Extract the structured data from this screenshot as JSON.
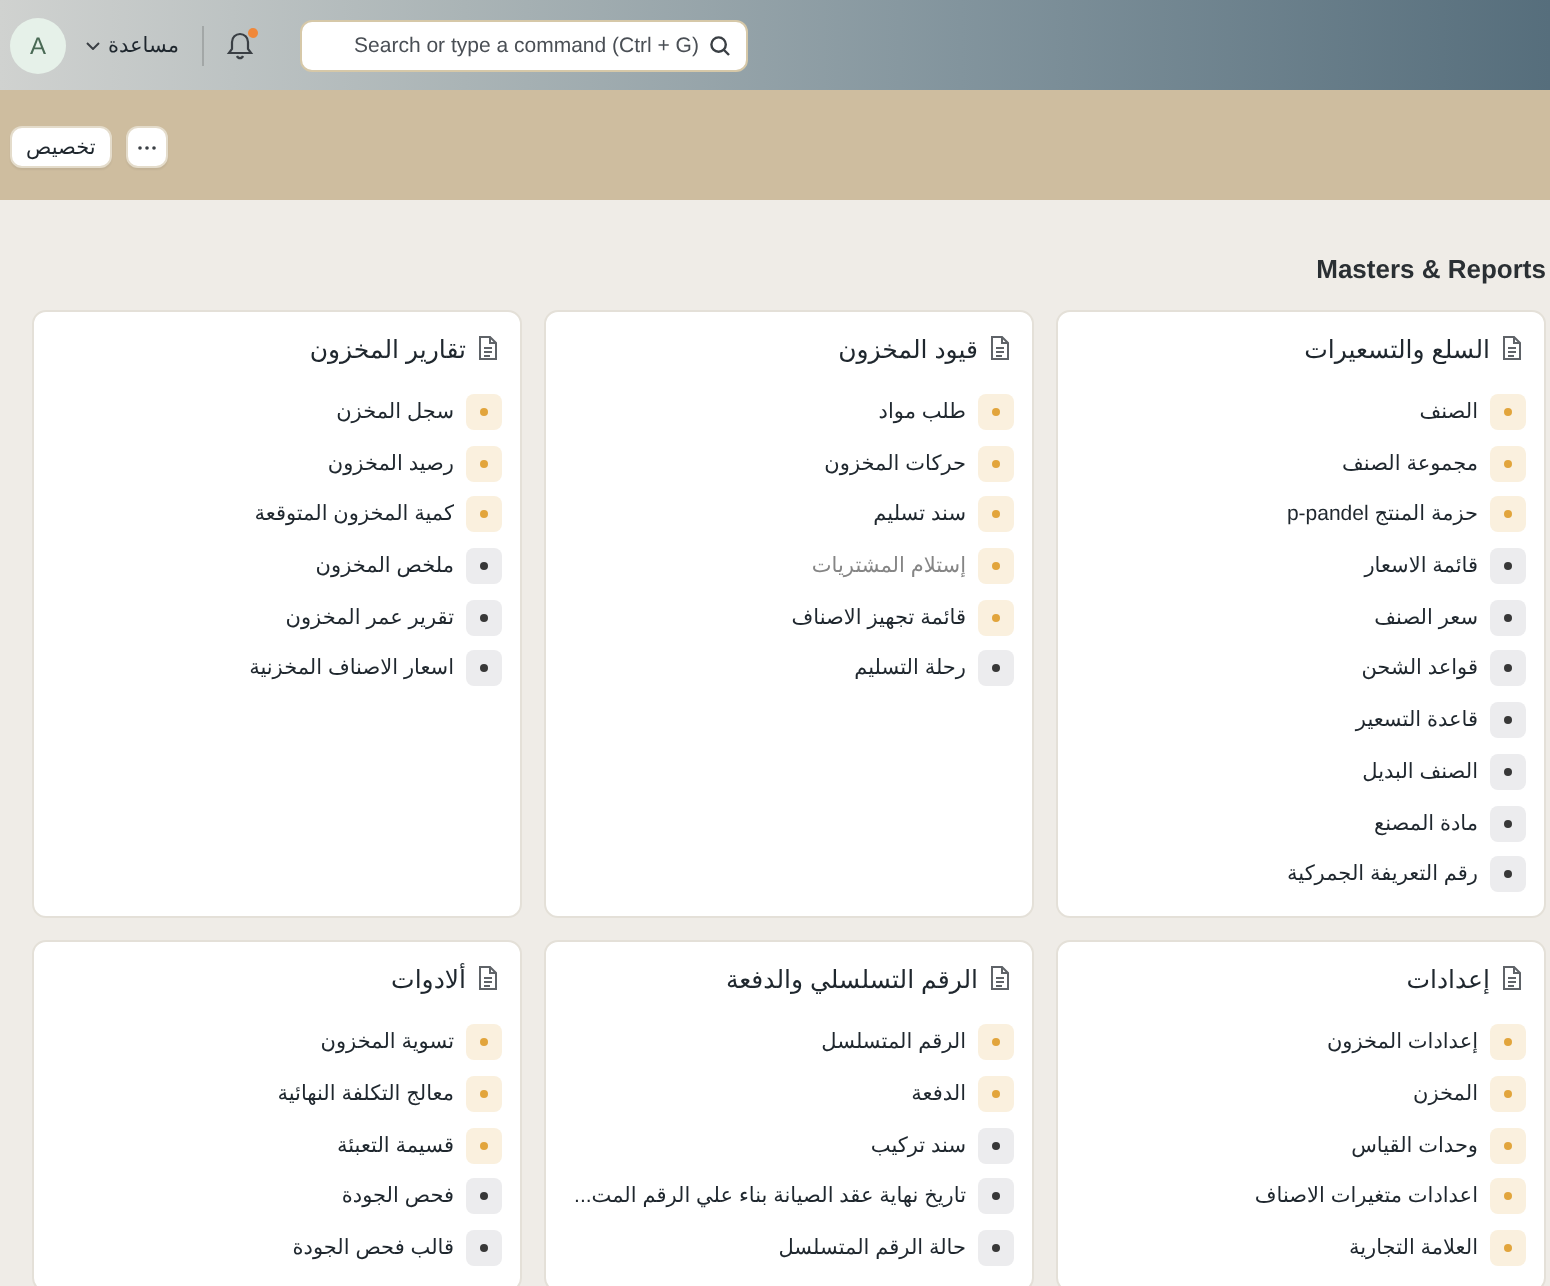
{
  "navbar": {
    "avatar": "A",
    "help": {
      "label": "مساعدة"
    },
    "notifications": {
      "unread": true
    },
    "search": {
      "placeholder": "Search or type a command (Ctrl + G)"
    }
  },
  "toolbar": {
    "buttons": [
      {
        "label": "تخصيص"
      }
    ]
  },
  "section": {
    "title": "Masters & Reports",
    "cards": [
      {
        "title": "السلع والتسعيرات",
        "items": [
          {
            "label": "الصنف",
            "color": "#e2a53c",
            "muted": false
          },
          {
            "label": "مجموعة الصنف",
            "color": "#e2a53c",
            "muted": false
          },
          {
            "label": "حزمة المنتج p-pandel",
            "color": "#e2a53c",
            "muted": false
          },
          {
            "label": "قائمة الاسعار",
            "color": "#383838",
            "muted": false
          },
          {
            "label": "سعر الصنف",
            "color": "#383838",
            "muted": false
          },
          {
            "label": "قواعد الشحن",
            "color": "#383838",
            "muted": false
          },
          {
            "label": "قاعدة التسعير",
            "color": "#383838",
            "muted": false
          },
          {
            "label": "الصنف البديل",
            "color": "#383838",
            "muted": false
          },
          {
            "label": "مادة المصنع",
            "color": "#383838",
            "muted": false
          },
          {
            "label": "رقم التعريفة الجمركية",
            "color": "#383838",
            "muted": false
          }
        ]
      },
      {
        "title": "قيود المخزون",
        "items": [
          {
            "label": "طلب مواد",
            "color": "#e2a53c",
            "muted": false
          },
          {
            "label": "حركات المخزون",
            "color": "#e2a53c",
            "muted": false
          },
          {
            "label": "سند تسليم",
            "color": "#e2a53c",
            "muted": false
          },
          {
            "label": "إستلام المشتريات",
            "color": "#e2a53c",
            "muted": true
          },
          {
            "label": "قائمة تجهيز الاصناف",
            "color": "#e2a53c",
            "muted": false
          },
          {
            "label": "رحلة التسليم",
            "color": "#383838",
            "muted": false
          }
        ]
      },
      {
        "title": "تقارير المخزون",
        "items": [
          {
            "label": "سجل المخزن",
            "color": "#e2a53c",
            "muted": false
          },
          {
            "label": "رصيد المخزون",
            "color": "#e2a53c",
            "muted": false
          },
          {
            "label": "كمية المخزون المتوقعة",
            "color": "#e2a53c",
            "muted": false
          },
          {
            "label": "ملخص المخزون",
            "color": "#383838",
            "muted": false
          },
          {
            "label": "تقرير عمر المخزون",
            "color": "#383838",
            "muted": false
          },
          {
            "label": "اسعار الاصناف المخزنية",
            "color": "#383838",
            "muted": false
          }
        ]
      },
      {
        "title": "إعدادات",
        "items": [
          {
            "label": "إعدادات المخزون",
            "color": "#e2a53c",
            "muted": false
          },
          {
            "label": "المخزن",
            "color": "#e2a53c",
            "muted": false
          },
          {
            "label": "وحدات القياس",
            "color": "#e2a53c",
            "muted": false
          },
          {
            "label": "اعدادات متغيرات الاصناف",
            "color": "#e2a53c",
            "muted": false
          },
          {
            "label": "العلامة التجارية",
            "color": "#e2a53c",
            "muted": false
          }
        ]
      },
      {
        "title": "الرقم التسلسلي والدفعة",
        "items": [
          {
            "label": "الرقم المتسلسل",
            "color": "#e2a53c",
            "muted": false
          },
          {
            "label": "الدفعة",
            "color": "#e2a53c",
            "muted": false
          },
          {
            "label": "سند تركيب",
            "color": "#383838",
            "muted": false
          },
          {
            "label": "تاريخ نهاية عقد الصيانة بناء علي الرقم المت...",
            "color": "#383838",
            "muted": false
          },
          {
            "label": "حالة الرقم المتسلسل",
            "color": "#383838",
            "muted": false
          }
        ]
      },
      {
        "title": "ألادوات",
        "items": [
          {
            "label": "تسوية المخزون",
            "color": "#e2a53c",
            "muted": false
          },
          {
            "label": "معالج التكلفة النهائية",
            "color": "#e2a53c",
            "muted": false
          },
          {
            "label": "قسيمة التعبئة",
            "color": "#e2a53c",
            "muted": false
          },
          {
            "label": "فحص الجودة",
            "color": "#383838",
            "muted": false
          },
          {
            "label": "قالب فحص الجودة",
            "color": "#383838",
            "muted": false
          }
        ]
      }
    ]
  }
}
